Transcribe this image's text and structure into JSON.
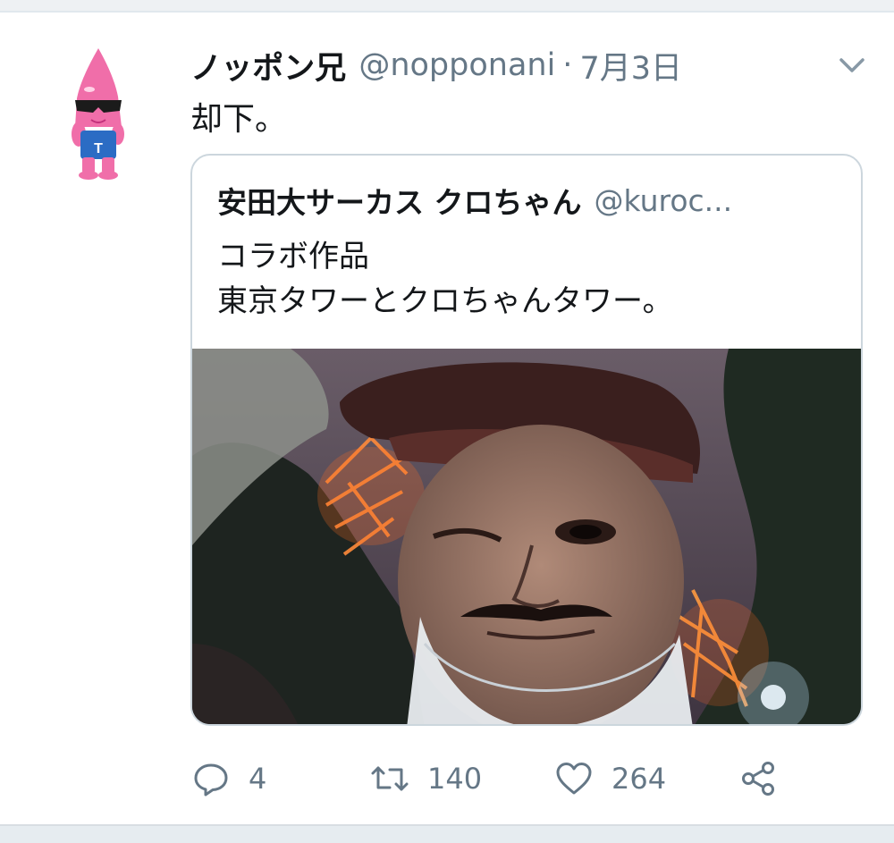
{
  "tweet": {
    "display_name": "ノッポン兄",
    "handle": "@nopponani",
    "separator": "·",
    "date": "7月3日",
    "text": "却下。",
    "avatar_icon": "noppon-mascot-avatar",
    "menu_icon": "chevron-down-icon"
  },
  "quoted_tweet": {
    "display_name": "安田大サーカス クロちゃん",
    "handle": "@kuroc...",
    "lines": [
      "コラボ作品",
      "東京タワーとクロちゃんタワー。"
    ],
    "photo": "selfie-with-tokyo-tower-at-night"
  },
  "actions": {
    "reply_count": "4",
    "retweet_count": "140",
    "like_count": "264"
  },
  "colors": {
    "text": "#14171a",
    "secondary": "#657786",
    "border": "#ccd6dd",
    "avatar_pink": "#f06ea9"
  }
}
